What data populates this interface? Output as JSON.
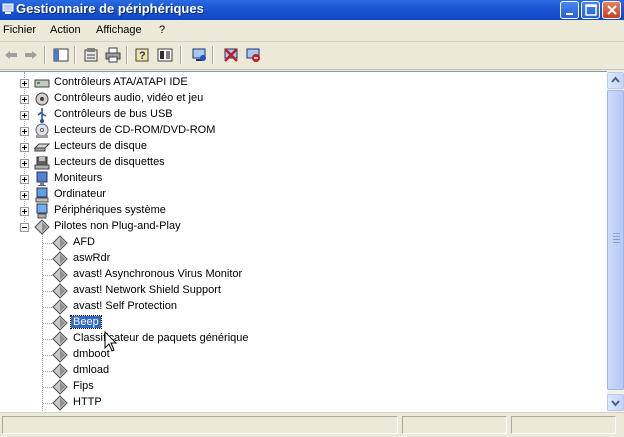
{
  "window": {
    "title": "Gestionnaire de périphériques"
  },
  "menu": [
    {
      "label": "Fichier"
    },
    {
      "label": "Action"
    },
    {
      "label": "Affichage"
    },
    {
      "label": "?"
    }
  ],
  "tree": {
    "categories": [
      {
        "label": "Contrôleurs ATA/ATAPI IDE",
        "icon": "ide-controller-icon"
      },
      {
        "label": "Contrôleurs audio, vidéo et jeu",
        "icon": "audio-icon"
      },
      {
        "label": "Contrôleurs de bus USB",
        "icon": "usb-icon"
      },
      {
        "label": "Lecteurs de CD-ROM/DVD-ROM",
        "icon": "cdrom-icon"
      },
      {
        "label": "Lecteurs de disque",
        "icon": "disk-drive-icon"
      },
      {
        "label": "Lecteurs de disquettes",
        "icon": "floppy-icon"
      },
      {
        "label": "Moniteurs",
        "icon": "monitor-icon"
      },
      {
        "label": "Ordinateur",
        "icon": "computer-icon"
      },
      {
        "label": "Périphériques système",
        "icon": "system-device-icon"
      },
      {
        "label": "Pilotes non Plug-and-Play",
        "icon": "driver-icon",
        "expanded": true
      }
    ],
    "drivers": [
      {
        "label": "AFD"
      },
      {
        "label": "aswRdr"
      },
      {
        "label": "avast! Asynchronous Virus Monitor"
      },
      {
        "label": "avast! Network Shield Support"
      },
      {
        "label": "avast! Self Protection"
      },
      {
        "label": "Beep",
        "selected": true
      },
      {
        "label": "Classificateur de paquets générique"
      },
      {
        "label": "dmboot"
      },
      {
        "label": "dmload"
      },
      {
        "label": "Fips"
      },
      {
        "label": "HTTP"
      }
    ]
  },
  "colors": {
    "titlebar": "#0d46c4",
    "selection": "#316ac5"
  }
}
